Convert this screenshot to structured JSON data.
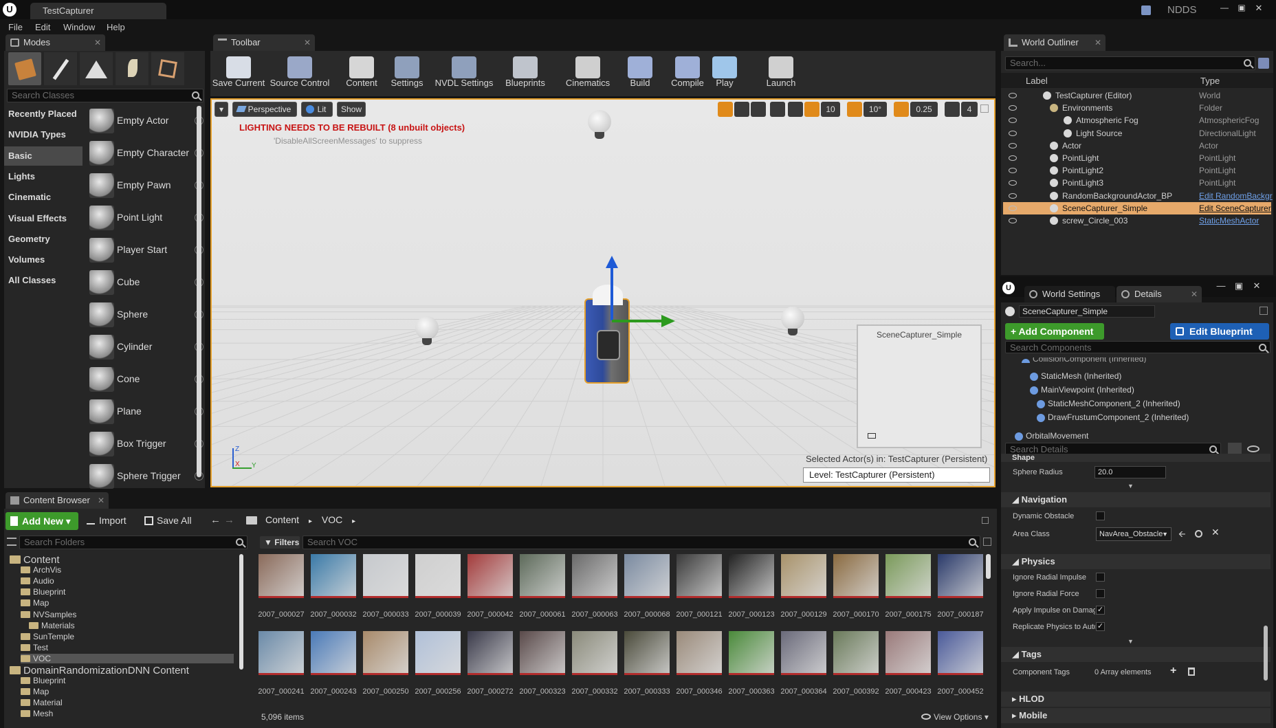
{
  "app": {
    "title": "TestCapturer",
    "badge": "NDDS"
  },
  "menu": [
    "File",
    "Edit",
    "Window",
    "Help"
  ],
  "tabs": {
    "modes": "Modes",
    "toolbar": "Toolbar",
    "outliner": "World Outliner",
    "world_settings": "World Settings",
    "details": "Details",
    "content_browser": "Content Browser"
  },
  "modes": {
    "search_placeholder": "Search Classes",
    "categories": [
      "Recently Placed",
      "NVIDIA Types",
      "Basic",
      "Lights",
      "Cinematic",
      "Visual Effects",
      "Geometry",
      "Volumes",
      "All Classes"
    ],
    "selected_category": "Basic",
    "items": [
      "Empty Actor",
      "Empty Character",
      "Empty Pawn",
      "Point Light",
      "Player Start",
      "Cube",
      "Sphere",
      "Cylinder",
      "Cone",
      "Plane",
      "Box Trigger",
      "Sphere Trigger"
    ]
  },
  "toolbar": {
    "buttons": [
      "Save Current",
      "Source Control",
      "Content",
      "Settings",
      "NVDL Settings",
      "Blueprints",
      "Cinematics",
      "Build",
      "Compile",
      "Play",
      "Launch"
    ]
  },
  "viewport": {
    "perspective": "Perspective",
    "lit": "Lit",
    "show": "Show",
    "warning": "LIGHTING NEEDS TO BE REBUILT (8 unbuilt objects)",
    "suppress": "'DisableAllScreenMessages' to suppress",
    "grid_snap": "10",
    "rot_snap": "10°",
    "scale_snap": "0.25",
    "cam_speed": "4",
    "preview_title": "SceneCapturer_Simple",
    "selected_actor": "Selected Actor(s) in:  TestCapturer (Persistent)",
    "level": "Level:  TestCapturer (Persistent)"
  },
  "outliner": {
    "search_placeholder": "Search...",
    "col_label": "Label",
    "col_type": "Type",
    "rows": [
      {
        "label": "TestCapturer (Editor)",
        "type": "World"
      },
      {
        "label": "Environments",
        "type": "Folder"
      },
      {
        "label": "Atmospheric Fog",
        "type": "AtmosphericFog"
      },
      {
        "label": "Light Source",
        "type": "DirectionalLight"
      },
      {
        "label": "Actor",
        "type": "Actor"
      },
      {
        "label": "PointLight",
        "type": "PointLight"
      },
      {
        "label": "PointLight2",
        "type": "PointLight"
      },
      {
        "label": "PointLight3",
        "type": "PointLight"
      },
      {
        "label": "RandomBackgroundActor_BP",
        "type": "Edit RandomBackgr"
      },
      {
        "label": "SceneCapturer_Simple",
        "type": "Edit SceneCapturer"
      },
      {
        "label": "screw_Circle_003",
        "type": "StaticMeshActor"
      }
    ]
  },
  "details": {
    "actor_name": "SceneCapturer_Simple",
    "add_component": "+ Add Component",
    "edit_blueprint": "Edit Blueprint",
    "search_components": "Search Components",
    "components": [
      "CollisionComponent (Inherited)",
      "StaticMesh (Inherited)",
      "MainViewpoint (Inherited)",
      "StaticMeshComponent_2 (Inherited)",
      "DrawFrustumComponent_2 (Inherited)",
      "OrbitalMovement"
    ],
    "search_details": "Search Details",
    "shape": "Shape",
    "sphere_radius_label": "Sphere Radius",
    "sphere_radius": "20.0",
    "navigation": "Navigation",
    "dynamic_obstacle": "Dynamic Obstacle",
    "area_class": "Area Class",
    "area_class_value": "NavArea_Obstacle",
    "physics": "Physics",
    "ignore_radial_impulse": "Ignore Radial Impulse",
    "ignore_radial_force": "Ignore Radial Force",
    "apply_impulse": "Apply Impulse on Damage",
    "replicate_physics": "Replicate Physics to Autonomous Proxy",
    "tags": "Tags",
    "component_tags": "Component Tags",
    "array_elements": "0 Array elements",
    "hlod": "HLOD",
    "mobile": "Mobile"
  },
  "content_browser": {
    "add_new": "Add New",
    "import": "Import",
    "save_all": "Save All",
    "path": [
      "Content",
      "VOC"
    ],
    "search_folders": "Search Folders",
    "filters": "Filters",
    "search_voc": "Search VOC",
    "folders": [
      {
        "name": "Content",
        "depth": 0
      },
      {
        "name": "ArchVis",
        "depth": 1
      },
      {
        "name": "Audio",
        "depth": 1
      },
      {
        "name": "Blueprint",
        "depth": 1
      },
      {
        "name": "Map",
        "depth": 1
      },
      {
        "name": "NVSamples",
        "depth": 1
      },
      {
        "name": "Materials",
        "depth": 2
      },
      {
        "name": "SunTemple",
        "depth": 1
      },
      {
        "name": "Test",
        "depth": 1
      },
      {
        "name": "VOC",
        "depth": 1
      },
      {
        "name": "DomainRandomizationDNN Content",
        "depth": 0
      },
      {
        "name": "Blueprint",
        "depth": 1
      },
      {
        "name": "Map",
        "depth": 1
      },
      {
        "name": "Material",
        "depth": 1
      },
      {
        "name": "Mesh",
        "depth": 1
      }
    ],
    "assets_row1": [
      "2007_000027",
      "2007_000032",
      "2007_000033",
      "2007_000039",
      "2007_000042",
      "2007_000061",
      "2007_000063",
      "2007_000068",
      "2007_000121",
      "2007_000123",
      "2007_000129",
      "2007_000170",
      "2007_000175",
      "2007_000187"
    ],
    "assets_row2": [
      "2007_000241",
      "2007_000243",
      "2007_000250",
      "2007_000256",
      "2007_000272",
      "2007_000323",
      "2007_000332",
      "2007_000333",
      "2007_000346",
      "2007_000363",
      "2007_000364",
      "2007_000392",
      "2007_000423",
      "2007_000452"
    ],
    "item_count": "5,096 items",
    "view_options": "View Options"
  }
}
